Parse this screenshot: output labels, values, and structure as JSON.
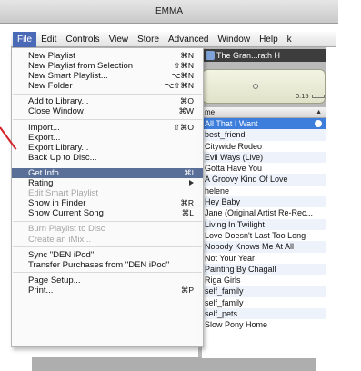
{
  "window": {
    "title": "EMMA"
  },
  "menubar": [
    "File",
    "Edit",
    "Controls",
    "View",
    "Store",
    "Advanced",
    "Window",
    "Help",
    "k"
  ],
  "now_playing": "The Gran...rath H",
  "lcd": {
    "time": "0:15"
  },
  "list": {
    "header": "me",
    "tracks": [
      "All That I Want",
      "best_friend",
      "Citywide Rodeo",
      "Evil Ways (Live)",
      "Gotta Have You",
      "A Groovy Kind Of Love",
      "helene",
      "Hey Baby",
      "Jane (Original Artist Re-Rec...",
      "Living In Twilight",
      "Love Doesn't Last Too Long",
      "Nobody Knows Me At All",
      "Not Your Year",
      "Painting By Chagall",
      "Riga Girls",
      "self_family",
      "self_family",
      "self_pets",
      "Slow Pony Home"
    ]
  },
  "file_menu": {
    "items": [
      {
        "label": "New Playlist",
        "shortcut": "⌘N"
      },
      {
        "label": "New Playlist from Selection",
        "shortcut": "⇧⌘N"
      },
      {
        "label": "New Smart Playlist...",
        "shortcut": "⌥⌘N"
      },
      {
        "label": "New Folder",
        "shortcut": "⌥⇧⌘N"
      },
      {
        "sep": true
      },
      {
        "label": "Add to Library...",
        "shortcut": "⌘O"
      },
      {
        "label": "Close Window",
        "shortcut": "⌘W"
      },
      {
        "sep": true
      },
      {
        "label": "Import...",
        "shortcut": "⇧⌘O"
      },
      {
        "label": "Export..."
      },
      {
        "label": "Export Library..."
      },
      {
        "label": "Back Up to Disc..."
      },
      {
        "sep": true
      },
      {
        "label": "Get Info",
        "shortcut": "⌘I",
        "highlighted": true
      },
      {
        "label": "Rating",
        "submenu": true
      },
      {
        "label": "Edit Smart Playlist",
        "disabled": true
      },
      {
        "label": "Show in Finder",
        "shortcut": "⌘R"
      },
      {
        "label": "Show Current Song",
        "shortcut": "⌘L"
      },
      {
        "sep": true
      },
      {
        "label": "Burn Playlist to Disc",
        "disabled": true
      },
      {
        "label": "Create an iMix...",
        "disabled": true
      },
      {
        "sep": true
      },
      {
        "label": "Sync \"DEN iPod\""
      },
      {
        "label": "Transfer Purchases from \"DEN iPod\""
      },
      {
        "sep": true
      },
      {
        "label": "Page Setup..."
      },
      {
        "label": "Print...",
        "shortcut": "⌘P"
      }
    ]
  },
  "colors": {
    "menu_highlight": "#5a6f98",
    "selected_row": "#3d7ddc",
    "callout": "#d6232a"
  }
}
